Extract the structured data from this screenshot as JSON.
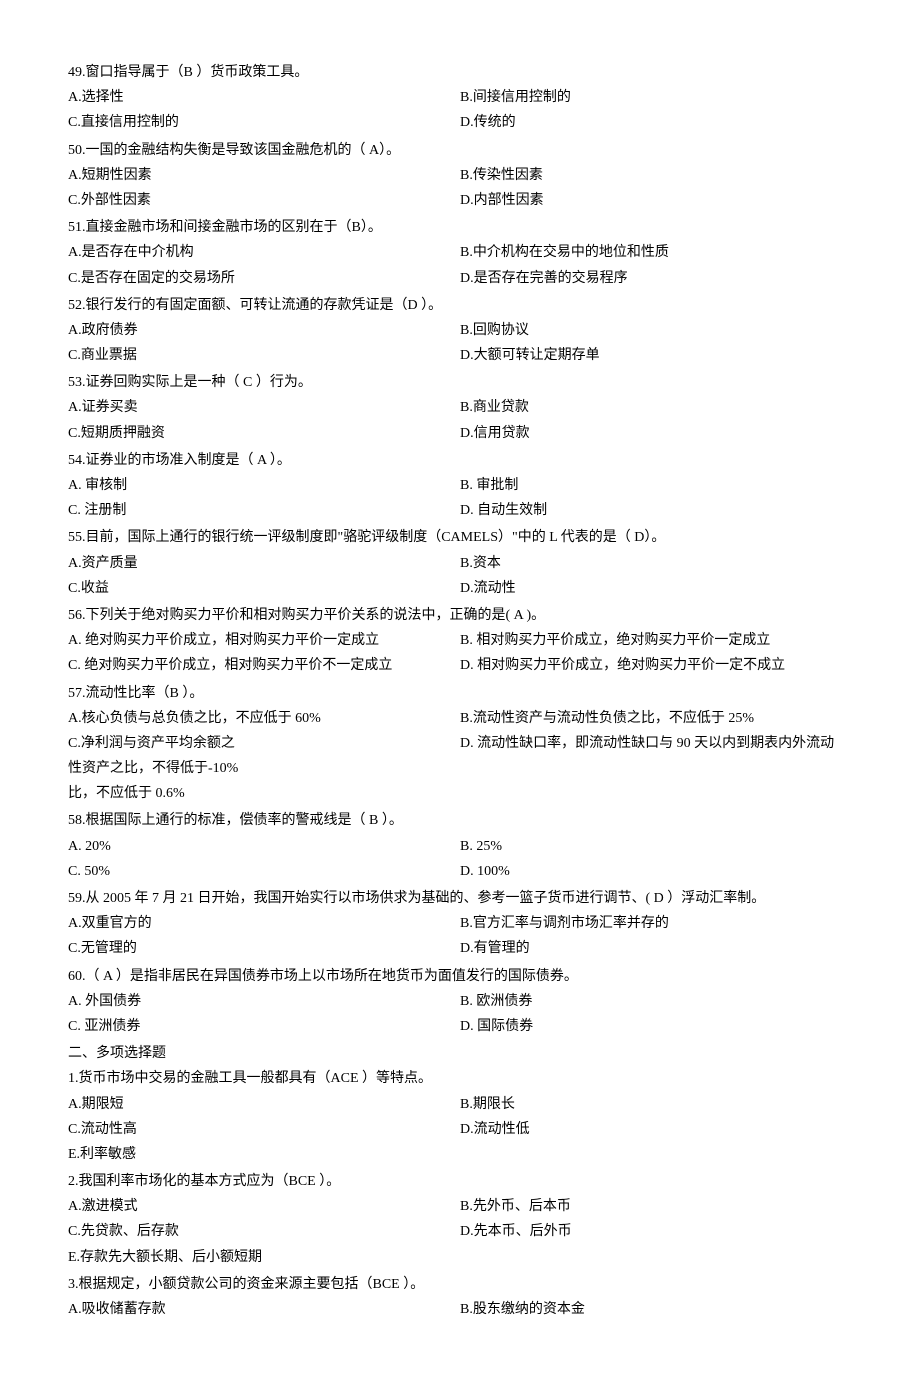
{
  "q49": {
    "stem": "49.窗口指导属于（B  ）货币政策工具。",
    "A": "A.选择性",
    "B": "B.间接信用控制的",
    "C": "C.直接信用控制的",
    "D": "D.传统的"
  },
  "q50": {
    "stem": "50.一国的金融结构失衡是导致该国金融危机的（ A）。",
    "A": "A.短期性因素",
    "B": "B.传染性因素",
    "C": "C.外部性因素",
    "D": "D.内部性因素"
  },
  "q51": {
    "stem": "51.直接金融市场和间接金融市场的区别在于（B）。",
    "A": "A.是否存在中介机构",
    "B": "B.中介机构在交易中的地位和性质",
    "C": "C.是否存在固定的交易场所",
    "D": "D.是否存在完善的交易程序"
  },
  "q52": {
    "stem": "52.银行发行的有固定面额、可转让流通的存款凭证是（D  ）。",
    "A": "A.政府债券",
    "B": "B.回购协议",
    "C": "C.商业票据",
    "D": "D.大额可转让定期存单"
  },
  "q53": {
    "stem": "53.证券回购实际上是一种（ C ）行为。",
    "A": "A.证券买卖",
    "B": "B.商业贷款",
    "C": "C.短期质押融资",
    "D": "D.信用贷款"
  },
  "q54": {
    "stem": "54.证券业的市场准入制度是（ A ）。",
    "A": "A. 审核制",
    "B": "B. 审批制",
    "C": "C. 注册制",
    "D": "D. 自动生效制"
  },
  "q55": {
    "stem": "55.目前，国际上通行的银行统一评级制度即\"骆驼评级制度（CAMELS）\"中的 L 代表的是（  D）。",
    "A": "A.资产质量",
    "B": "B.资本",
    "C": "C.收益",
    "D": "D.流动性"
  },
  "q56": {
    "stem": "56.下列关于绝对购买力平价和相对购买力平价关系的说法中，正确的是( A )。",
    "A": "A. 绝对购买力平价成立，相对购买力平价一定成立",
    "B": "B. 相对购买力平价成立，绝对购买力平价一定成立",
    "C": "C. 绝对购买力平价成立，相对购买力平价不一定成立",
    "D": "D. 相对购买力平价成立，绝对购买力平价一定不成立"
  },
  "q57": {
    "stem": "57.流动性比率（B  ）。",
    "A": "A.核心负债与总负债之比，不应低于 60%",
    "B": "B.流动性资产与流动性负债之比，不应低于 25%",
    "C": "C.净利润与资产平均余额之",
    "D": "D. 流动性缺口率，即流动性缺口与 90 天以内到期表内外流动",
    "tail1": "性资产之比，不得低于-10%",
    "tail2": "比，不应低于 0.6%"
  },
  "q58": {
    "stem": "58.根据国际上通行的标准，偿债率的警戒线是（ B ）。",
    "A": "A. 20%",
    "B": "B. 25%",
    "C": "C. 50%",
    "D": "D. 100%"
  },
  "q59": {
    "stem": "59.从 2005 年 7 月 21 日开始，我国开始实行以市场供求为基础的、参考一篮子货币进行调节、( D ）浮动汇率制。",
    "A": "A.双重官方的",
    "B": "B.官方汇率与调剂市场汇率并存的",
    "C": "C.无管理的",
    "D": "D.有管理的"
  },
  "q60": {
    "stem": "60.（ A ）是指非居民在异国债券市场上以市场所在地货币为面值发行的国际债券。",
    "A": "A. 外国债券",
    "B": "B. 欧洲债券",
    "C": "C. 亚洲债券",
    "D": "D. 国际债券"
  },
  "section2": {
    "title": "二、多项选择题"
  },
  "m1": {
    "stem": "1.货币市场中交易的金融工具一般都具有（ACE  ）等特点。",
    "A": "A.期限短",
    "B": "B.期限长",
    "C": "C.流动性高",
    "D": "D.流动性低",
    "E": "E.利率敏感"
  },
  "m2": {
    "stem": "2.我国利率市场化的基本方式应为（BCE ）。",
    "A": "A.激进模式",
    "B": "B.先外币、后本币",
    "C": "C.先贷款、后存款",
    "D": "D.先本币、后外币",
    "E": "E.存款先大额长期、后小额短期"
  },
  "m3": {
    "stem": "3.根据规定，小额贷款公司的资金来源主要包括（BCE  ）。",
    "A": "A.吸收储蓄存款",
    "B": "B.股东缴纳的资本金"
  }
}
